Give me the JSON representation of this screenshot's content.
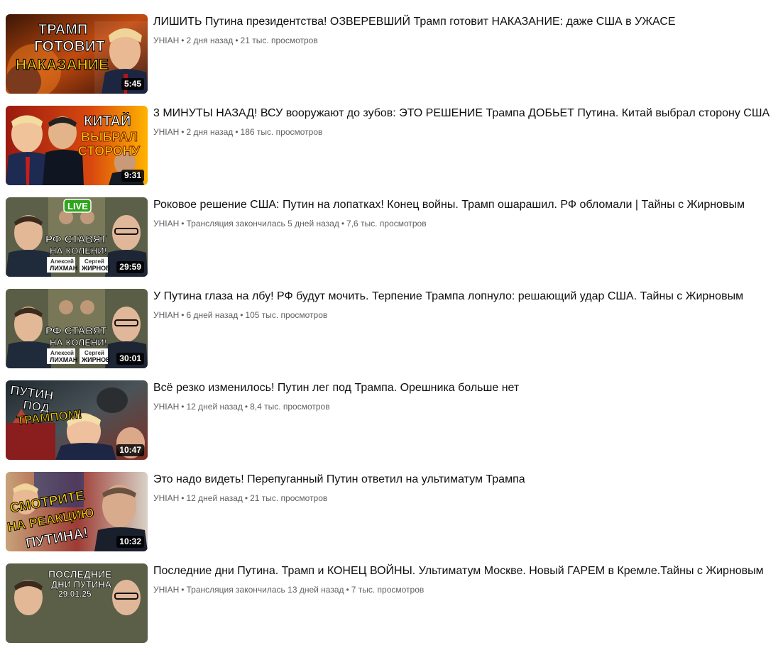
{
  "videos": [
    {
      "title": "ЛИШИТЬ Путина президентства! ОЗВЕРЕВШИЙ Трамп готовит НАКАЗАНИЕ: даже США в УЖАСЕ",
      "channel": "УНІАН",
      "status": "",
      "age": "2 дня назад",
      "views": "21 тыс. просмотров",
      "duration": "5:45",
      "thumb_text": [
        "ТРАМП",
        "ГОТОВИТ",
        "НАКАЗАНИЕ"
      ],
      "badge": ""
    },
    {
      "title": "3 МИНУТЫ НАЗАД! ВСУ вооружают до зубов: ЭТО РЕШЕНИЕ Трампа ДОБЬЕТ Путина. Китай выбрал сторону США",
      "channel": "УНІАН",
      "status": "",
      "age": "2 дня назад",
      "views": "186 тыс. просмотров",
      "duration": "9:31",
      "thumb_text": [
        "КИТАЙ",
        "ВЫБРАЛ",
        "СТОРОНУ"
      ],
      "badge": ""
    },
    {
      "title": "Роковое решение США: Путин на лопатках! Конец войны. Трамп ошарашил. РФ обломали | Тайны с Жирновым",
      "channel": "УНІАН",
      "status": "Трансляция закончилась",
      "age": "5 дней назад",
      "views": "7,6 тыс. просмотров",
      "duration": "29:59",
      "thumb_text": [
        "РФ СТАВЯТ",
        "НА КОЛЕНИ!",
        "Алексей",
        "ЛИХМАН",
        "Сергей",
        "ЖИРНОВ"
      ],
      "badge": "LIVE"
    },
    {
      "title": "У Путина глаза на лбу! РФ будут мочить. Терпение Трампа лопнуло: решающий удар США. Тайны с Жирновым",
      "channel": "УНІАН",
      "status": "",
      "age": "6 дней назад",
      "views": "105 тыс. просмотров",
      "duration": "30:01",
      "thumb_text": [
        "РФ СТАВЯТ",
        "НА КОЛЕНИ!",
        "Алексей",
        "ЛИХМАН",
        "Сергей",
        "ЖИРНОВ"
      ],
      "badge": ""
    },
    {
      "title": "Всё резко изменилось! Путин лег под Трампа. Орешника больше нет",
      "channel": "УНІАН",
      "status": "",
      "age": "12 дней назад",
      "views": "8,4 тыс. просмотров",
      "duration": "10:47",
      "thumb_text": [
        "ПУТИН",
        "ПОД",
        "ТРАМПОМ!"
      ],
      "badge": ""
    },
    {
      "title": "Это надо видеть! Перепуганный Путин ответил на ультиматум Трампа",
      "channel": "УНІАН",
      "status": "",
      "age": "12 дней назад",
      "views": "21 тыс. просмотров",
      "duration": "10:32",
      "thumb_text": [
        "СМОТРИТЕ",
        "НА РЕАКЦИЮ",
        "ПУТИНА!"
      ],
      "badge": ""
    },
    {
      "title": "Последние дни Путина. Трамп и КОНЕЦ ВОЙНЫ. Ультиматум Москве. Новый ГАРЕМ в Кремле.Тайны с Жирновым",
      "channel": "УНІАН",
      "status": "Трансляция закончилась",
      "age": "13 дней назад",
      "views": "7 тыс. просмотров",
      "duration": "",
      "thumb_text": [
        "ПОСЛЕДНИЕ",
        "ДНИ ПУТИНА",
        "29.01.25"
      ],
      "badge": ""
    }
  ],
  "colors": {
    "title": "#0f0f0f",
    "meta": "#606060",
    "duration_bg": "#000000",
    "live_green": "#2fa51f",
    "accent_yellow": "#ffd200",
    "accent_red": "#d51a1a"
  }
}
